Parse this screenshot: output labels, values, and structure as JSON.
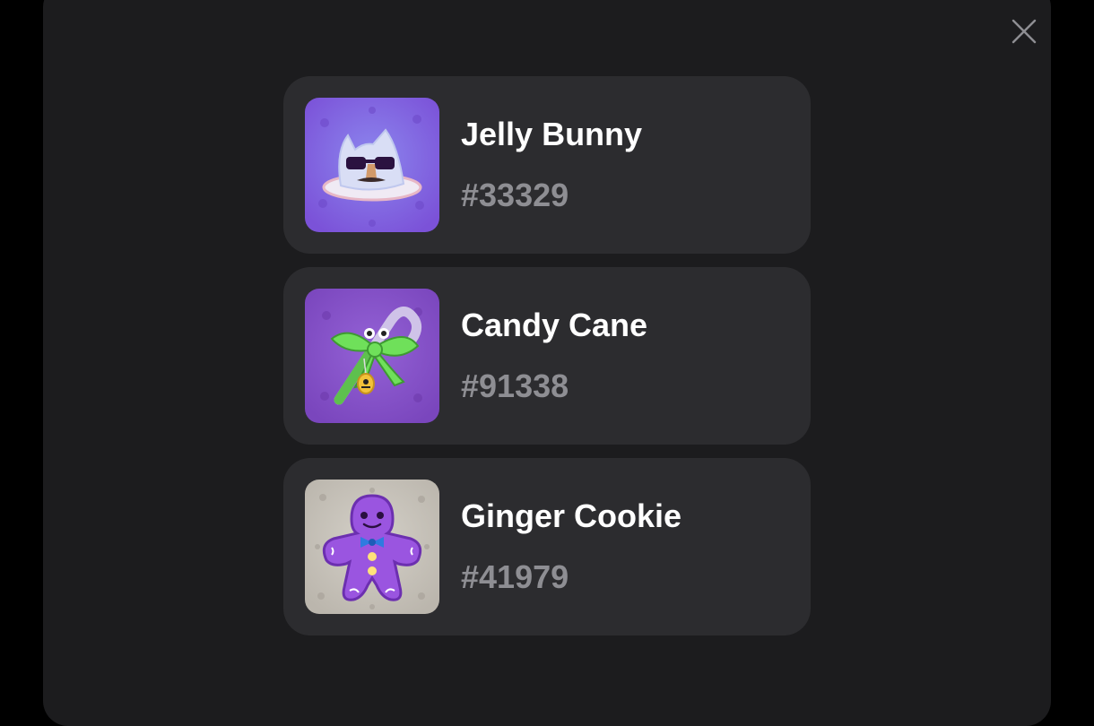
{
  "colors": {
    "page_bg": "#000000",
    "modal_bg": "#1c1c1e",
    "card_bg": "#2c2c2f",
    "title": "#ffffff",
    "number": "#8e8e93",
    "close_icon": "#8e8e93"
  },
  "close": {
    "icon": "close-icon"
  },
  "items": [
    {
      "title": "Jelly Bunny",
      "number": "#33329",
      "thumb_bg": "#8a6ee0",
      "icon": "jelly-bunny-icon"
    },
    {
      "title": "Candy Cane",
      "number": "#91338",
      "thumb_bg": "#8453c9",
      "icon": "candy-cane-icon"
    },
    {
      "title": "Ginger Cookie",
      "number": "#41979",
      "thumb_bg": "#c7c3bc",
      "icon": "ginger-cookie-icon"
    }
  ]
}
